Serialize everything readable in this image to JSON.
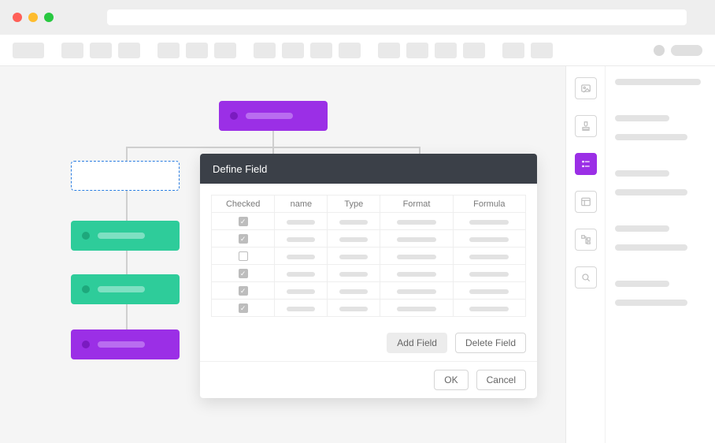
{
  "dialog": {
    "title": "Define Field",
    "columns": [
      "Checked",
      "name",
      "Type",
      "Format",
      "Formula"
    ],
    "rows": [
      {
        "checked": true
      },
      {
        "checked": true
      },
      {
        "checked": false
      },
      {
        "checked": true
      },
      {
        "checked": true
      },
      {
        "checked": true
      }
    ],
    "buttons": {
      "add_field": "Add Field",
      "delete_field": "Delete Field",
      "ok": "OK",
      "cancel": "Cancel"
    }
  },
  "right_tools": [
    {
      "name": "image-icon",
      "active": false
    },
    {
      "name": "stamp-icon",
      "active": false
    },
    {
      "name": "list-icon",
      "active": true
    },
    {
      "name": "layout-icon",
      "active": false
    },
    {
      "name": "tree-icon",
      "active": false
    },
    {
      "name": "search-icon",
      "active": false
    }
  ],
  "colors": {
    "purple": "#9b2fe6",
    "green": "#2ecc9a",
    "dialog_header": "#3b4048"
  }
}
